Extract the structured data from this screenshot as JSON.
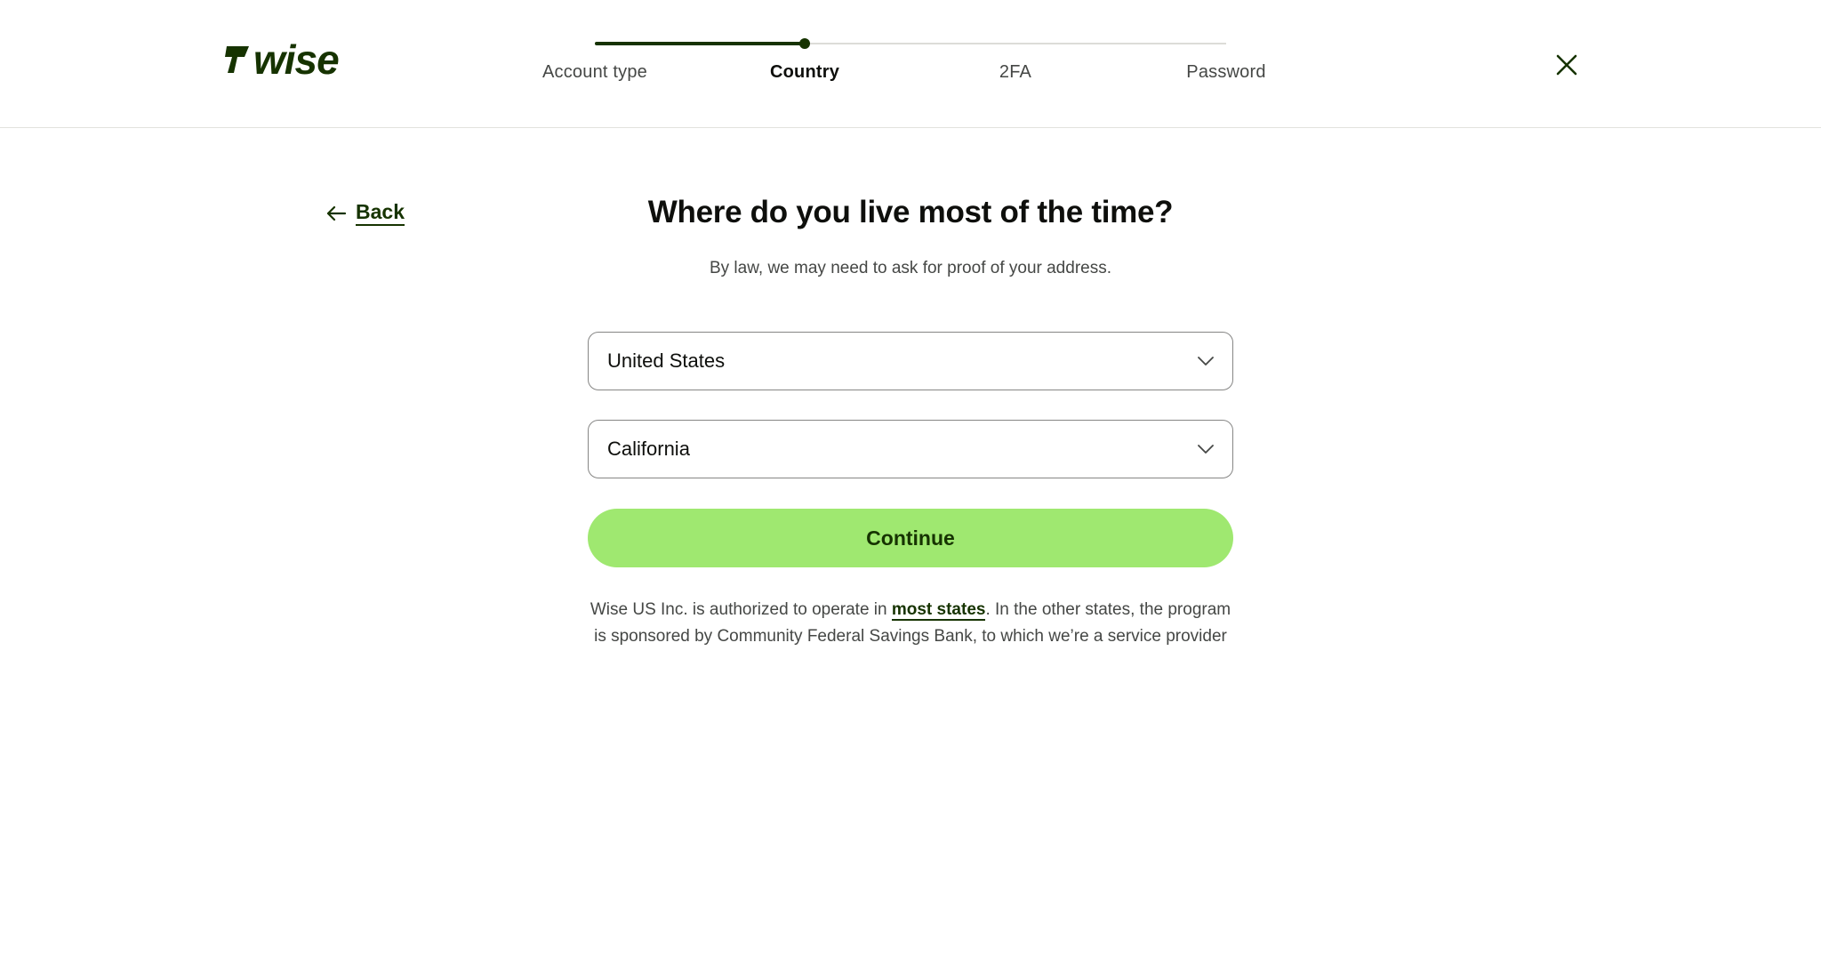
{
  "header": {
    "logo_text": "wise",
    "steps": [
      {
        "label": "Account type",
        "state": "completed"
      },
      {
        "label": "Country",
        "state": "active"
      },
      {
        "label": "2FA",
        "state": "pending"
      },
      {
        "label": "Password",
        "state": "pending"
      }
    ],
    "progress_fraction": 0.333,
    "close_icon": "close-icon"
  },
  "main": {
    "back_label": "Back",
    "back_icon": "arrow-left-icon",
    "title": "Where do you live most of the time?",
    "subtitle": "By law, we may need to ask for proof of your address.",
    "country_select": {
      "value": "United States",
      "icon": "chevron-down-icon"
    },
    "state_select": {
      "value": "California",
      "icon": "chevron-down-icon"
    },
    "continue_label": "Continue",
    "disclaimer": {
      "prefix": "Wise US Inc. is authorized to operate in ",
      "link_text": "most states",
      "suffix": ". In the other states, the program is sponsored by Community Federal Savings Bank, to which we’re a service provider"
    }
  },
  "colors": {
    "brand_dark_green": "#163300",
    "brand_bright_green": "#9fe870",
    "text_primary": "#0e0f0c",
    "text_secondary": "#454745",
    "border": "#868685"
  }
}
